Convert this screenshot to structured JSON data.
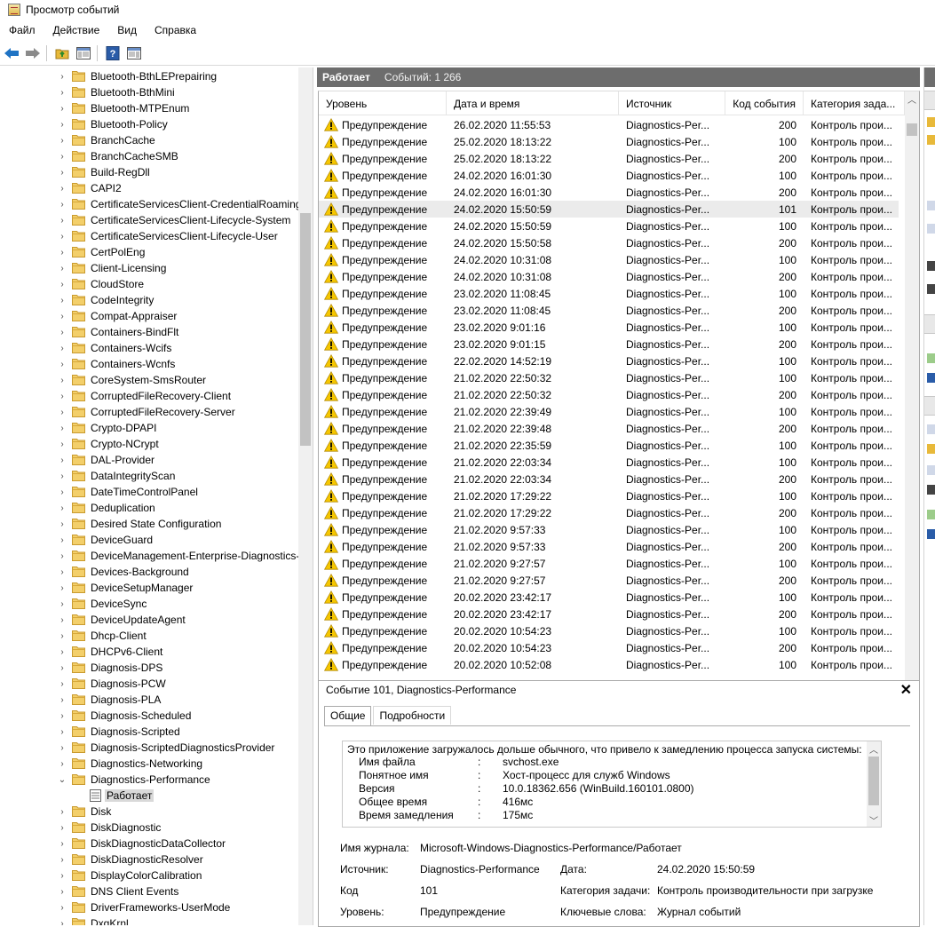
{
  "window": {
    "title": "Просмотр событий",
    "icon": "event-viewer-icon"
  },
  "menu": [
    "Файл",
    "Действие",
    "Вид",
    "Справка"
  ],
  "toolbar": [
    "back-arrow-icon",
    "forward-arrow-icon",
    "up-folder-icon",
    "show-hide-tree-icon",
    "help-icon",
    "show-hide-action-pane-icon"
  ],
  "tree": {
    "items": [
      {
        "label": "Bluetooth-BthLEPrepairing",
        "expanded": false
      },
      {
        "label": "Bluetooth-BthMini",
        "expanded": false
      },
      {
        "label": "Bluetooth-MTPEnum",
        "expanded": false
      },
      {
        "label": "Bluetooth-Policy",
        "expanded": false
      },
      {
        "label": "BranchCache",
        "expanded": false
      },
      {
        "label": "BranchCacheSMB",
        "expanded": false
      },
      {
        "label": "Build-RegDll",
        "expanded": false
      },
      {
        "label": "CAPI2",
        "expanded": false
      },
      {
        "label": "CertificateServicesClient-CredentialRoaming",
        "expanded": false
      },
      {
        "label": "CertificateServicesClient-Lifecycle-System",
        "expanded": false
      },
      {
        "label": "CertificateServicesClient-Lifecycle-User",
        "expanded": false
      },
      {
        "label": "CertPolEng",
        "expanded": false
      },
      {
        "label": "Client-Licensing",
        "expanded": false
      },
      {
        "label": "CloudStore",
        "expanded": false
      },
      {
        "label": "CodeIntegrity",
        "expanded": false
      },
      {
        "label": "Compat-Appraiser",
        "expanded": false
      },
      {
        "label": "Containers-BindFlt",
        "expanded": false
      },
      {
        "label": "Containers-Wcifs",
        "expanded": false
      },
      {
        "label": "Containers-Wcnfs",
        "expanded": false
      },
      {
        "label": "CoreSystem-SmsRouter",
        "expanded": false
      },
      {
        "label": "CorruptedFileRecovery-Client",
        "expanded": false
      },
      {
        "label": "CorruptedFileRecovery-Server",
        "expanded": false
      },
      {
        "label": "Crypto-DPAPI",
        "expanded": false
      },
      {
        "label": "Crypto-NCrypt",
        "expanded": false
      },
      {
        "label": "DAL-Provider",
        "expanded": false
      },
      {
        "label": "DataIntegrityScan",
        "expanded": false
      },
      {
        "label": "DateTimeControlPanel",
        "expanded": false
      },
      {
        "label": "Deduplication",
        "expanded": false
      },
      {
        "label": "Desired State Configuration",
        "expanded": false
      },
      {
        "label": "DeviceGuard",
        "expanded": false
      },
      {
        "label": "DeviceManagement-Enterprise-Diagnostics-",
        "expanded": false
      },
      {
        "label": "Devices-Background",
        "expanded": false
      },
      {
        "label": "DeviceSetupManager",
        "expanded": false
      },
      {
        "label": "DeviceSync",
        "expanded": false
      },
      {
        "label": "DeviceUpdateAgent",
        "expanded": false
      },
      {
        "label": "Dhcp-Client",
        "expanded": false
      },
      {
        "label": "DHCPv6-Client",
        "expanded": false
      },
      {
        "label": "Diagnosis-DPS",
        "expanded": false
      },
      {
        "label": "Diagnosis-PCW",
        "expanded": false
      },
      {
        "label": "Diagnosis-PLA",
        "expanded": false
      },
      {
        "label": "Diagnosis-Scheduled",
        "expanded": false
      },
      {
        "label": "Diagnosis-Scripted",
        "expanded": false
      },
      {
        "label": "Diagnosis-ScriptedDiagnosticsProvider",
        "expanded": false
      },
      {
        "label": "Diagnostics-Networking",
        "expanded": false
      },
      {
        "label": "Diagnostics-Performance",
        "expanded": true
      },
      {
        "label": "Работает",
        "leaf": true,
        "selected": true
      },
      {
        "label": "Disk",
        "expanded": false
      },
      {
        "label": "DiskDiagnostic",
        "expanded": false
      },
      {
        "label": "DiskDiagnosticDataCollector",
        "expanded": false
      },
      {
        "label": "DiskDiagnosticResolver",
        "expanded": false
      },
      {
        "label": "DisplayColorCalibration",
        "expanded": false
      },
      {
        "label": "DNS Client Events",
        "expanded": false
      },
      {
        "label": "DriverFrameworks-UserMode",
        "expanded": false
      },
      {
        "label": "DxgKrnl",
        "expanded": false
      }
    ]
  },
  "log": {
    "name": "Работает",
    "count_label": "Событий: 1 266"
  },
  "grid": {
    "columns": [
      "Уровень",
      "Дата и время",
      "Источник",
      "Код события",
      "Категория зада..."
    ],
    "rows": [
      [
        "Предупреждение",
        "26.02.2020 11:55:53",
        "Diagnostics-Per...",
        "200",
        "Контроль прои..."
      ],
      [
        "Предупреждение",
        "25.02.2020 18:13:22",
        "Diagnostics-Per...",
        "100",
        "Контроль прои..."
      ],
      [
        "Предупреждение",
        "25.02.2020 18:13:22",
        "Diagnostics-Per...",
        "200",
        "Контроль прои..."
      ],
      [
        "Предупреждение",
        "24.02.2020 16:01:30",
        "Diagnostics-Per...",
        "100",
        "Контроль прои..."
      ],
      [
        "Предупреждение",
        "24.02.2020 16:01:30",
        "Diagnostics-Per...",
        "200",
        "Контроль прои..."
      ],
      [
        "Предупреждение",
        "24.02.2020 15:50:59",
        "Diagnostics-Per...",
        "101",
        "Контроль прои..."
      ],
      [
        "Предупреждение",
        "24.02.2020 15:50:59",
        "Diagnostics-Per...",
        "100",
        "Контроль прои..."
      ],
      [
        "Предупреждение",
        "24.02.2020 15:50:58",
        "Diagnostics-Per...",
        "200",
        "Контроль прои..."
      ],
      [
        "Предупреждение",
        "24.02.2020 10:31:08",
        "Diagnostics-Per...",
        "100",
        "Контроль прои..."
      ],
      [
        "Предупреждение",
        "24.02.2020 10:31:08",
        "Diagnostics-Per...",
        "200",
        "Контроль прои..."
      ],
      [
        "Предупреждение",
        "23.02.2020 11:08:45",
        "Diagnostics-Per...",
        "100",
        "Контроль прои..."
      ],
      [
        "Предупреждение",
        "23.02.2020 11:08:45",
        "Diagnostics-Per...",
        "200",
        "Контроль прои..."
      ],
      [
        "Предупреждение",
        "23.02.2020 9:01:16",
        "Diagnostics-Per...",
        "100",
        "Контроль прои..."
      ],
      [
        "Предупреждение",
        "23.02.2020 9:01:15",
        "Diagnostics-Per...",
        "200",
        "Контроль прои..."
      ],
      [
        "Предупреждение",
        "22.02.2020 14:52:19",
        "Diagnostics-Per...",
        "100",
        "Контроль прои..."
      ],
      [
        "Предупреждение",
        "21.02.2020 22:50:32",
        "Diagnostics-Per...",
        "100",
        "Контроль прои..."
      ],
      [
        "Предупреждение",
        "21.02.2020 22:50:32",
        "Diagnostics-Per...",
        "200",
        "Контроль прои..."
      ],
      [
        "Предупреждение",
        "21.02.2020 22:39:49",
        "Diagnostics-Per...",
        "100",
        "Контроль прои..."
      ],
      [
        "Предупреждение",
        "21.02.2020 22:39:48",
        "Diagnostics-Per...",
        "200",
        "Контроль прои..."
      ],
      [
        "Предупреждение",
        "21.02.2020 22:35:59",
        "Diagnostics-Per...",
        "100",
        "Контроль прои..."
      ],
      [
        "Предупреждение",
        "21.02.2020 22:03:34",
        "Diagnostics-Per...",
        "100",
        "Контроль прои..."
      ],
      [
        "Предупреждение",
        "21.02.2020 22:03:34",
        "Diagnostics-Per...",
        "200",
        "Контроль прои..."
      ],
      [
        "Предупреждение",
        "21.02.2020 17:29:22",
        "Diagnostics-Per...",
        "100",
        "Контроль прои..."
      ],
      [
        "Предупреждение",
        "21.02.2020 17:29:22",
        "Diagnostics-Per...",
        "200",
        "Контроль прои..."
      ],
      [
        "Предупреждение",
        "21.02.2020 9:57:33",
        "Diagnostics-Per...",
        "100",
        "Контроль прои..."
      ],
      [
        "Предупреждение",
        "21.02.2020 9:57:33",
        "Diagnostics-Per...",
        "200",
        "Контроль прои..."
      ],
      [
        "Предупреждение",
        "21.02.2020 9:27:57",
        "Diagnostics-Per...",
        "100",
        "Контроль прои..."
      ],
      [
        "Предупреждение",
        "21.02.2020 9:27:57",
        "Diagnostics-Per...",
        "200",
        "Контроль прои..."
      ],
      [
        "Предупреждение",
        "20.02.2020 23:42:17",
        "Diagnostics-Per...",
        "100",
        "Контроль прои..."
      ],
      [
        "Предупреждение",
        "20.02.2020 23:42:17",
        "Diagnostics-Per...",
        "200",
        "Контроль прои..."
      ],
      [
        "Предупреждение",
        "20.02.2020 10:54:23",
        "Diagnostics-Per...",
        "100",
        "Контроль прои..."
      ],
      [
        "Предупреждение",
        "20.02.2020 10:54:23",
        "Diagnostics-Per...",
        "200",
        "Контроль прои..."
      ],
      [
        "Предупреждение",
        "20.02.2020 10:52:08",
        "Diagnostics-Per...",
        "100",
        "Контроль прои..."
      ]
    ],
    "selected_row_index": 5
  },
  "details": {
    "title": "Событие 101, Diagnostics-Performance",
    "close_glyph": "✕",
    "tabs": [
      "Общие",
      "Подробности"
    ],
    "description": {
      "intro": "Это приложение загружалось дольше обычного, что привело к замедлению процесса запуска системы:",
      "colon": ":",
      "pairs": [
        {
          "k": "Имя файла",
          "v": "svchost.exe"
        },
        {
          "k": "Понятное имя",
          "v": "Хост-процесс для служб Windows"
        },
        {
          "k": "Версия",
          "v": "10.0.18362.656 (WinBuild.160101.0800)"
        },
        {
          "k": "Общее время",
          "v": "416мс"
        },
        {
          "k": "Время замедления",
          "v": "175мс"
        }
      ]
    },
    "fields": {
      "log_name_label": "Имя журнала:",
      "log_name": "Microsoft-Windows-Diagnostics-Performance/Работает",
      "source_label": "Источник:",
      "source": "Diagnostics-Performance",
      "date_label": "Дата:",
      "date": "24.02.2020 15:50:59",
      "code_label": "Код",
      "code": "101",
      "task_label": "Категория задачи:",
      "task": "Контроль производительности при загрузке",
      "level_label": "Уровень:",
      "level": "Предупреждение",
      "keywords_label": "Ключевые слова:",
      "keywords": "Журнал событий"
    }
  },
  "colors": {
    "header_bg": "#6d6d6d",
    "selected_row": "#ebebeb",
    "warning": "#f6c700",
    "folder": "#e8b93a"
  }
}
